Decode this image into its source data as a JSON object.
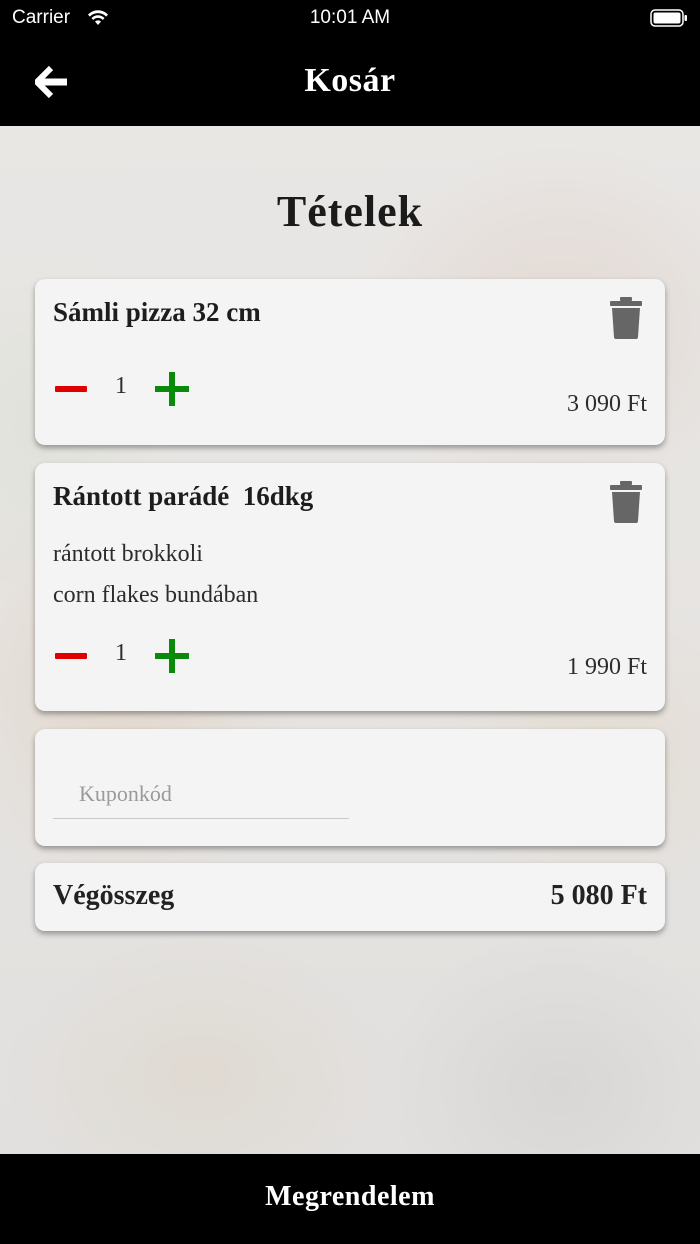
{
  "status_bar": {
    "carrier": "Carrier",
    "time": "10:01 AM"
  },
  "nav": {
    "title": "Kosár",
    "back_icon": "arrow-left-icon"
  },
  "cart": {
    "section_title": "Tételek",
    "items": [
      {
        "name": "Sámli pizza 32 cm",
        "description": [],
        "quantity": "1",
        "price": "3 090 Ft"
      },
      {
        "name": "Rántott parádé  16dkg",
        "description": [
          "rántott brokkoli",
          "corn flakes bundában"
        ],
        "quantity": "1",
        "price": "1 990 Ft"
      }
    ],
    "coupon": {
      "placeholder": "Kuponkód",
      "value": ""
    },
    "total": {
      "label": "Végösszeg",
      "value": "5 080 Ft"
    }
  },
  "footer": {
    "order_button": "Megrendelem"
  },
  "colors": {
    "bar_background": "#000000",
    "card_background": "#f4f4f4",
    "minus": "#e00000",
    "plus": "#0a8a0a",
    "trash": "#666666"
  }
}
